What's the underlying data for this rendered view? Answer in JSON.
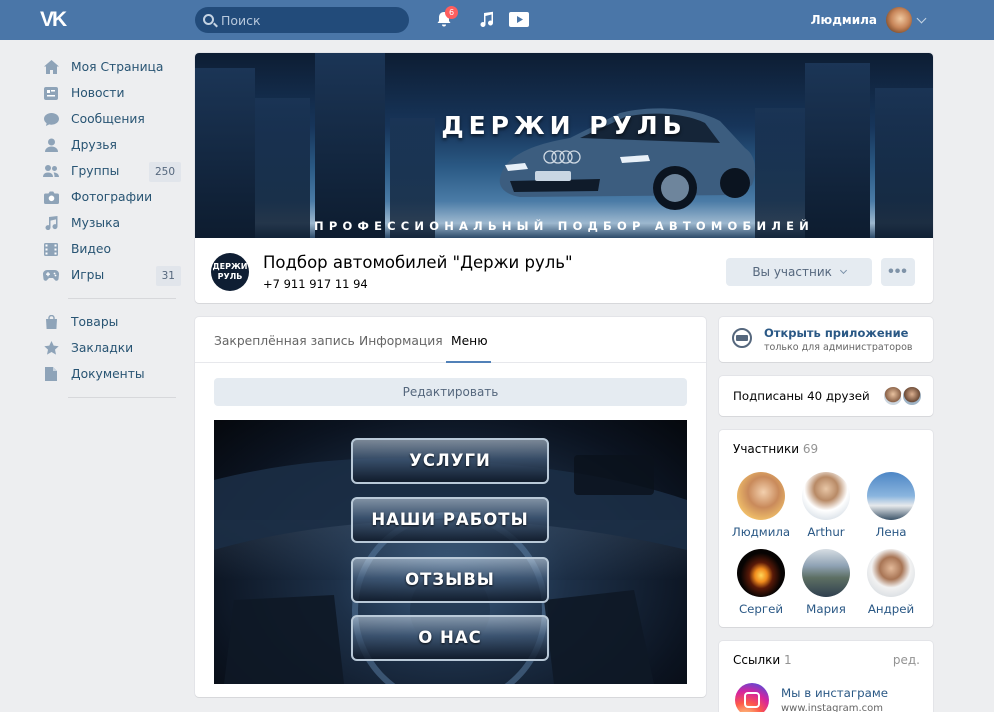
{
  "topbar": {
    "logo": "VK",
    "search_placeholder": "Поиск",
    "notif_count": "6",
    "user_name": "Людмила"
  },
  "sidebar": {
    "items": [
      {
        "label": "Моя Страница",
        "icon": "home-icon"
      },
      {
        "label": "Новости",
        "icon": "news-icon"
      },
      {
        "label": "Сообщения",
        "icon": "messages-icon"
      },
      {
        "label": "Друзья",
        "icon": "friends-icon"
      },
      {
        "label": "Группы",
        "icon": "groups-icon",
        "badge": "250"
      },
      {
        "label": "Фотографии",
        "icon": "camera-icon"
      },
      {
        "label": "Музыка",
        "icon": "music-icon"
      },
      {
        "label": "Видео",
        "icon": "video-icon"
      },
      {
        "label": "Игры",
        "icon": "gamepad-icon",
        "badge": "31"
      }
    ],
    "items2": [
      {
        "label": "Товары",
        "icon": "bag-icon"
      },
      {
        "label": "Закладки",
        "icon": "star-icon"
      },
      {
        "label": "Документы",
        "icon": "document-icon"
      }
    ]
  },
  "cover": {
    "title": "ДЕРЖИ РУЛЬ",
    "subtitle": "ПРОФЕССИОНАЛЬНЫЙ ПОДБОР АВТОМОБИЛЕЙ"
  },
  "group": {
    "logo_text_1": "ДЕРЖИ",
    "logo_text_2": "РУЛЬ",
    "name": "Подбор автомобилей \"Держи руль\"",
    "phone": "+7 911 917 11 94",
    "member_button": "Вы участник",
    "more_button": "•••"
  },
  "main": {
    "tabs": [
      "Закреплённая запись",
      "Информация",
      "Меню"
    ],
    "active_tab": "Меню",
    "edit_button": "Редактировать",
    "menu_buttons": [
      "УСЛУГИ",
      "НАШИ РАБОТЫ",
      "ОТЗЫВЫ",
      "О НАС"
    ]
  },
  "side": {
    "app_title": "Открыть приложение",
    "app_sub": "только для администраторов",
    "friends_text": "Подписаны 40 друзей",
    "members_title": "Участники",
    "members_count": "69",
    "members": [
      "Людмила",
      "Arthur",
      "Лена",
      "Сергей",
      "Мария",
      "Андрей"
    ],
    "links_title": "Ссылки",
    "links_count": "1",
    "links_edit": "ред.",
    "link_title": "Мы в инстаграме",
    "link_url": "www.instagram.com"
  },
  "colors": {
    "topbar": "#4a76a8",
    "link": "#2a5885",
    "background": "#edeef0"
  }
}
